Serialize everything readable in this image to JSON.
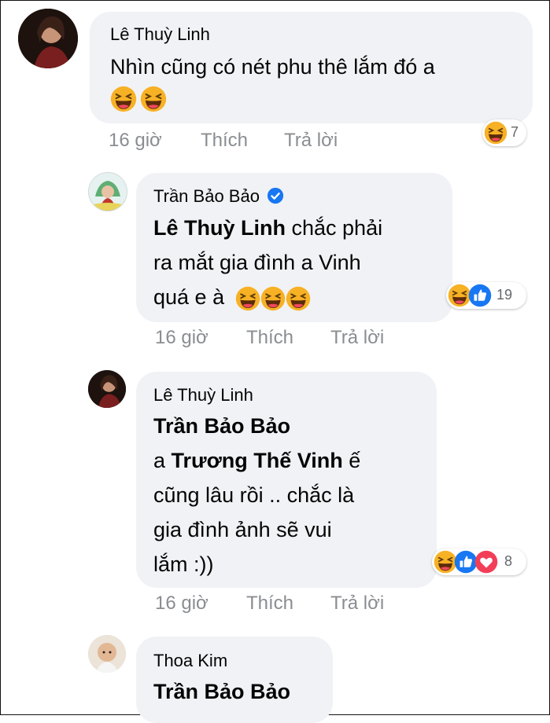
{
  "comments": [
    {
      "author": "Lê Thuỳ Linh",
      "text_line1": "Nhìn cũng có nét phu thê lắm đó a",
      "time": "16 giờ",
      "like_label": "Thích",
      "reply_label": "Trả lời",
      "reaction_count": "7"
    },
    {
      "author": "Trần Bảo Bảo",
      "mention": "Lê Thuỳ Linh",
      "text_after_mention": " chắc phải",
      "text_line2": "ra mắt gia đình a Vinh",
      "text_line3": "quá e à",
      "time": "16 giờ",
      "like_label": "Thích",
      "reply_label": "Trả lời",
      "reaction_count": "19"
    },
    {
      "author": "Lê Thuỳ Linh",
      "mention1": "Trần Bảo Bảo",
      "line2_prefix": "a ",
      "mention2": "Trương Thế Vinh",
      "line2_suffix": " ế",
      "text_line3": "cũng lâu rồi .. chắc là",
      "text_line4": "gia đình ảnh sẽ vui",
      "text_line5": "lắm :))",
      "time": "16 giờ",
      "like_label": "Thích",
      "reply_label": "Trả lời",
      "reaction_count": "8"
    },
    {
      "author": "Thoa Kim",
      "mention": "Trần Bảo Bảo"
    }
  ],
  "icons": {
    "verified": "verified-badge-icon",
    "haha": "haha-emoji-icon",
    "like": "like-reaction-icon",
    "love": "love-reaction-icon"
  },
  "colors": {
    "bubble": "#f0f2f5",
    "meta_text": "#8a8d91",
    "like_blue": "#1877f2",
    "love_red": "#f33e58",
    "haha_yellow": "#f7b125"
  }
}
